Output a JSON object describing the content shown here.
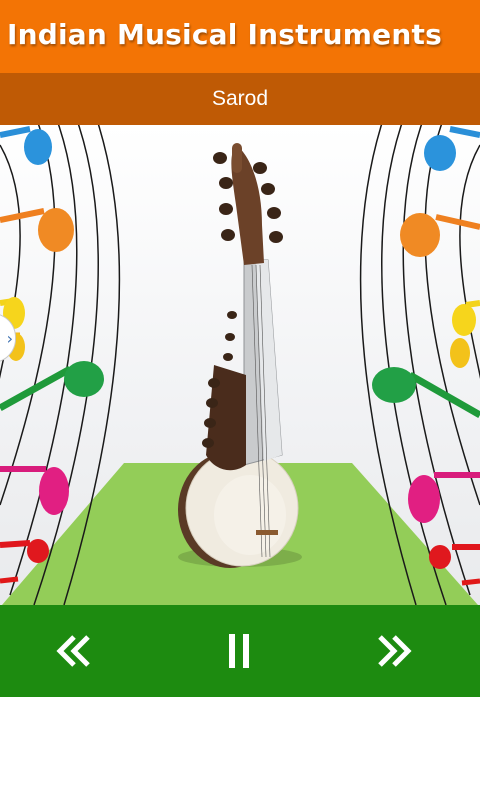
{
  "app": {
    "title": "Indian Musical Instruments"
  },
  "instrument": {
    "name": "Sarod"
  },
  "controls": {
    "previous_icon": "double-chevron-left-icon",
    "pause_icon": "pause-icon",
    "next_icon": "double-chevron-right-icon"
  },
  "colors": {
    "header": "#f37405",
    "subheader": "#bf5a05",
    "controls_bar": "#1d8b10",
    "platform": "#93cd58"
  }
}
